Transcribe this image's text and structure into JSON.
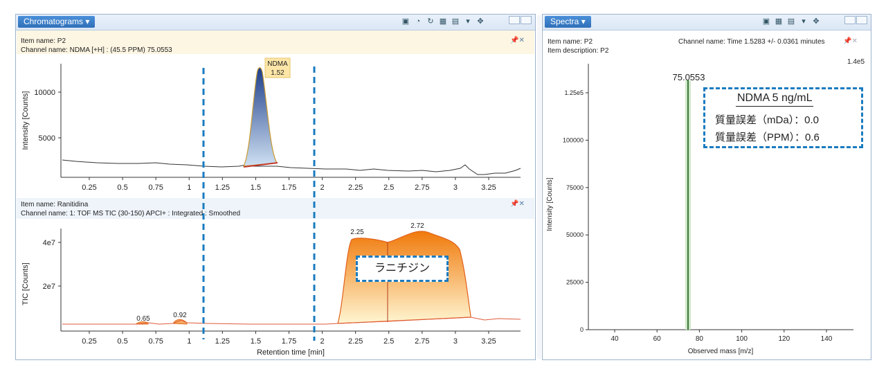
{
  "left_panel": {
    "tab_label": "Chromatograms ▾",
    "top": {
      "item_name": "Item name: P2",
      "channel_name": "Channel name: NDMA [+H] : (45.5 PPM) 75.0553",
      "ylabel": "Intensity [Counts]",
      "yticks": [
        "10000",
        "5000"
      ],
      "peak_label": "NDMA",
      "peak_time": "1.52"
    },
    "bottom": {
      "item_name": "Item name: Ranitidina",
      "channel_name": "Channel name: 1: TOF MS TIC (30-150) APCI+ : Integrated : Smoothed",
      "ylabel": "TIC [Counts]",
      "yticks": [
        "4e7",
        "2e7"
      ],
      "peak_labels": [
        "0.65",
        "0.92",
        "2.25",
        "2.72"
      ],
      "callout": "ラニチジン"
    },
    "xticks": [
      "0.25",
      "0.5",
      "0.75",
      "1",
      "1.25",
      "1.5",
      "1.75",
      "2",
      "2.25",
      "2.5",
      "2.75",
      "3",
      "3.25"
    ],
    "xlabel": "Retention time [min]"
  },
  "right_panel": {
    "tab_label": "Spectra ▾",
    "item_name": "Item name: P2",
    "item_description": "Item description: P2",
    "channel_name": "Channel name: Time 1.5283 +/- 0.0361 minutes",
    "ymax_label": "1.4e5",
    "yticks": [
      "1.25e5",
      "100000",
      "75000",
      "50000",
      "25000",
      "0"
    ],
    "xticks": [
      "40",
      "60",
      "80",
      "100",
      "120",
      "140"
    ],
    "ylabel": "Intensity [Counts]",
    "xlabel": "Observed mass [m/z]",
    "peak_label": "75.0553",
    "callout": {
      "title": "NDMA 5 ng/mL",
      "line1": "質量誤差（mDa）：0.0",
      "line2": "質量誤差（PPM）：0.6"
    }
  },
  "colors": {
    "peak_fill_top": "#1e3f8a",
    "peak_fill_bottom": "#cfe0f2",
    "tic_fill_top": "#f07a0c",
    "tic_fill_bottom": "#fff3c8",
    "dashed_marker": "#1a7bbf",
    "spectrum_line": "#3a7a3a"
  },
  "chart_data": [
    {
      "type": "line",
      "xlabel": "",
      "ylabel": "Intensity [Counts]",
      "xlim": [
        0,
        3.5
      ],
      "peaks": [
        {
          "label": "NDMA",
          "x": 1.52,
          "y": 12500
        }
      ],
      "x": [
        0,
        0.25,
        0.5,
        0.75,
        1,
        1.25,
        1.4,
        1.52,
        1.65,
        1.75,
        2,
        2.25,
        2.5,
        2.75,
        3,
        3.1,
        3.25,
        3.5
      ],
      "y": [
        2300,
        2000,
        1900,
        1800,
        1600,
        1400,
        1800,
        12500,
        1500,
        1300,
        1300,
        1200,
        1200,
        1100,
        1150,
        1900,
        900,
        1300
      ]
    },
    {
      "type": "area",
      "xlabel": "Retention time [min]",
      "ylabel": "TIC [Counts]",
      "xlim": [
        0,
        3.5
      ],
      "peaks": [
        {
          "label": "0.65",
          "x": 0.65
        },
        {
          "label": "0.92",
          "x": 0.92
        },
        {
          "label": "2.25",
          "x": 2.25
        },
        {
          "label": "2.72",
          "x": 2.72
        }
      ],
      "x": [
        0,
        0.5,
        0.65,
        0.8,
        0.92,
        1.0,
        1.5,
        2.0,
        2.1,
        2.2,
        2.25,
        2.5,
        2.72,
        2.9,
        3.1,
        3.2,
        3.5
      ],
      "y": [
        3000000,
        3000000,
        4000000,
        3000000,
        6000000,
        3200000,
        3200000,
        3300000,
        4000000,
        40000000,
        42000000,
        41000000,
        45000000,
        42000000,
        6000000,
        4000000,
        4000000
      ]
    },
    {
      "type": "bar",
      "xlabel": "Observed mass [m/z]",
      "ylabel": "Intensity [Counts]",
      "xlim": [
        30,
        150
      ],
      "ylim": [
        0,
        140000
      ],
      "x": [
        75.0553
      ],
      "y": [
        128000
      ]
    }
  ]
}
